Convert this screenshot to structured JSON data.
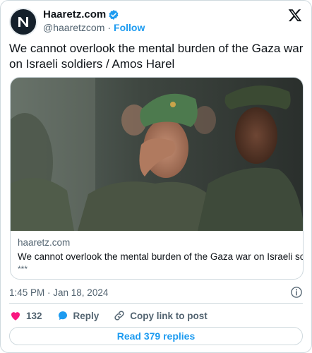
{
  "author": {
    "display_name": "Haaretz.com",
    "handle": "@haaretzcom",
    "separator": "·",
    "follow_label": "Follow",
    "verified_color": "#1d9bf0",
    "avatar_icon": "haaretz-logo-icon"
  },
  "platform_icon": "x-logo-icon",
  "tweet": {
    "text": "We cannot overlook the mental burden of the Gaza war on Israeli soldiers / Amos Harel"
  },
  "link_card": {
    "image_icon": "soldiers-photo",
    "domain": "haaretz.com",
    "title": "We cannot overlook the mental burden of the Gaza war on Israeli soldiers",
    "description": "***"
  },
  "timestamp": "1:45 PM · Jan 18, 2024",
  "info_icon": "info-icon",
  "actions": {
    "like_count": "132",
    "reply_label": "Reply",
    "copy_label": "Copy link to post"
  },
  "read_replies_label": "Read 379 replies",
  "colors": {
    "accent": "#1d9bf0",
    "like": "#f91880",
    "text": "#0f1419",
    "secondary": "#536471",
    "border": "#cfd9de"
  }
}
